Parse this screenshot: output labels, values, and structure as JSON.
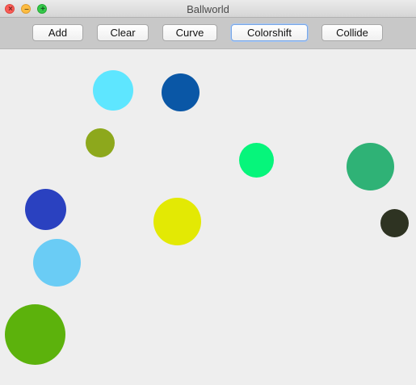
{
  "window": {
    "title": "Ballworld"
  },
  "toolbar": {
    "buttons": [
      {
        "label": "Add"
      },
      {
        "label": "Clear"
      },
      {
        "label": "Curve"
      },
      {
        "label": "Colorshift"
      },
      {
        "label": "Collide"
      }
    ]
  },
  "balls": [
    {
      "color": "#5ee6ff"
    },
    {
      "color": "#0a57a6"
    },
    {
      "color": "#8da81c"
    },
    {
      "color": "#06f57b"
    },
    {
      "color": "#2fb276"
    },
    {
      "color": "#2a41c0"
    },
    {
      "color": "#e3e904"
    },
    {
      "color": "#2e3322"
    },
    {
      "color": "#6accf5"
    },
    {
      "color": "#5cb20c"
    }
  ]
}
